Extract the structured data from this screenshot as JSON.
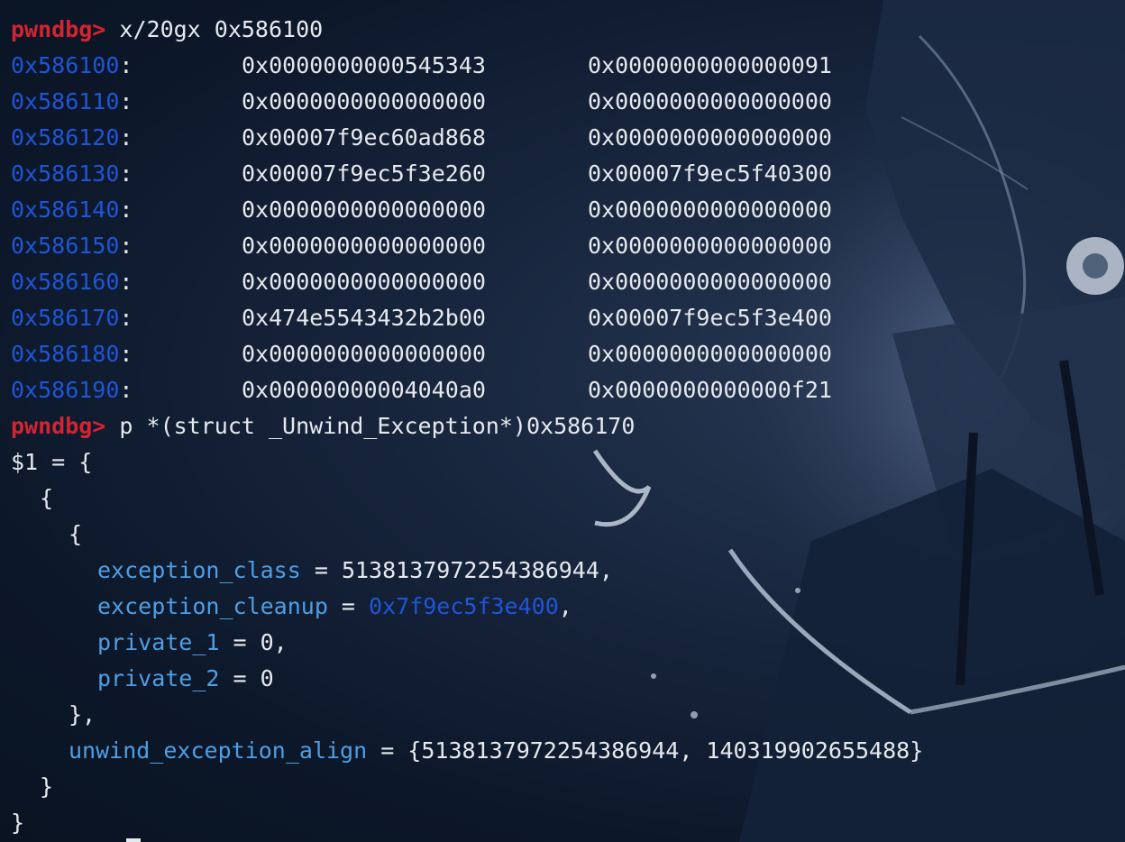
{
  "terminal": {
    "prompt": "pwndbg>",
    "command1": "x/20gx 0x586100",
    "memory_rows": [
      {
        "addr": "0x586100",
        "v1": "0x0000000000545343",
        "v2": "0x0000000000000091"
      },
      {
        "addr": "0x586110",
        "v1": "0x0000000000000000",
        "v2": "0x0000000000000000"
      },
      {
        "addr": "0x586120",
        "v1": "0x00007f9ec60ad868",
        "v2": "0x0000000000000000"
      },
      {
        "addr": "0x586130",
        "v1": "0x00007f9ec5f3e260",
        "v2": "0x00007f9ec5f40300"
      },
      {
        "addr": "0x586140",
        "v1": "0x0000000000000000",
        "v2": "0x0000000000000000"
      },
      {
        "addr": "0x586150",
        "v1": "0x0000000000000000",
        "v2": "0x0000000000000000"
      },
      {
        "addr": "0x586160",
        "v1": "0x0000000000000000",
        "v2": "0x0000000000000000"
      },
      {
        "addr": "0x586170",
        "v1": "0x474e5543432b2b00",
        "v2": "0x00007f9ec5f3e400"
      },
      {
        "addr": "0x586180",
        "v1": "0x0000000000000000",
        "v2": "0x0000000000000000"
      },
      {
        "addr": "0x586190",
        "v1": "0x00000000004040a0",
        "v2": "0x0000000000000f21"
      }
    ],
    "command2": "p *(struct _Unwind_Exception*)0x586170",
    "result_head": "$1 = {",
    "open_brace": "{",
    "exception_class_name": "exception_class",
    "exception_class_value": "5138137972254386944,",
    "exception_cleanup_name": "exception_cleanup",
    "exception_cleanup_value": "0x7f9ec5f3e400",
    "private_1_name": "private_1",
    "private_1_value": "0,",
    "private_2_name": "private_2",
    "private_2_value": "0",
    "inner_close": "},",
    "align_name": "unwind_exception_align",
    "align_value": "{5138137972254386944, 140319902655488}",
    "close_brace": "}",
    "colors": {
      "prompt": "#d52331",
      "address": "#1f55d8",
      "field": "#4e9fe6",
      "text": "#e6e9ee",
      "background": "#0a1628"
    }
  }
}
